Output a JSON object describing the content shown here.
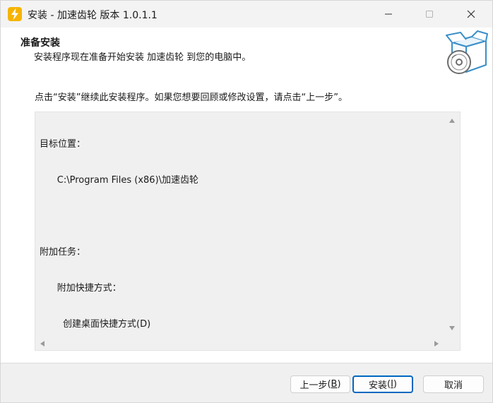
{
  "window": {
    "title": "安装 - 加速齿轮 版本 1.0.1.1",
    "controls": {
      "minimize_icon": "minimize-icon",
      "maximize_icon": "maximize-icon",
      "close_icon": "close-icon"
    }
  },
  "header": {
    "title": "准备安装",
    "subtitle": "安装程序现在准备开始安装 加速齿轮 到您的电脑中。"
  },
  "instruction": "点击“安装”继续此安装程序。如果您想要回顾或修改设置，请点击“上一步”。",
  "memo": {
    "lines": [
      "目标位置：",
      "      C:\\Program Files (x86)\\加速齿轮",
      "",
      "附加任务：",
      "      附加快捷方式：",
      "        创建桌面快捷方式(D)"
    ]
  },
  "buttons": {
    "back": {
      "label": "上一步",
      "accel": "B"
    },
    "install": {
      "label": "安装",
      "accel": "I"
    },
    "cancel": {
      "label": "取消"
    }
  },
  "colors": {
    "accent": "#0067c0",
    "titlebar": "#f3f3f3",
    "panel": "#f0f0f0"
  }
}
